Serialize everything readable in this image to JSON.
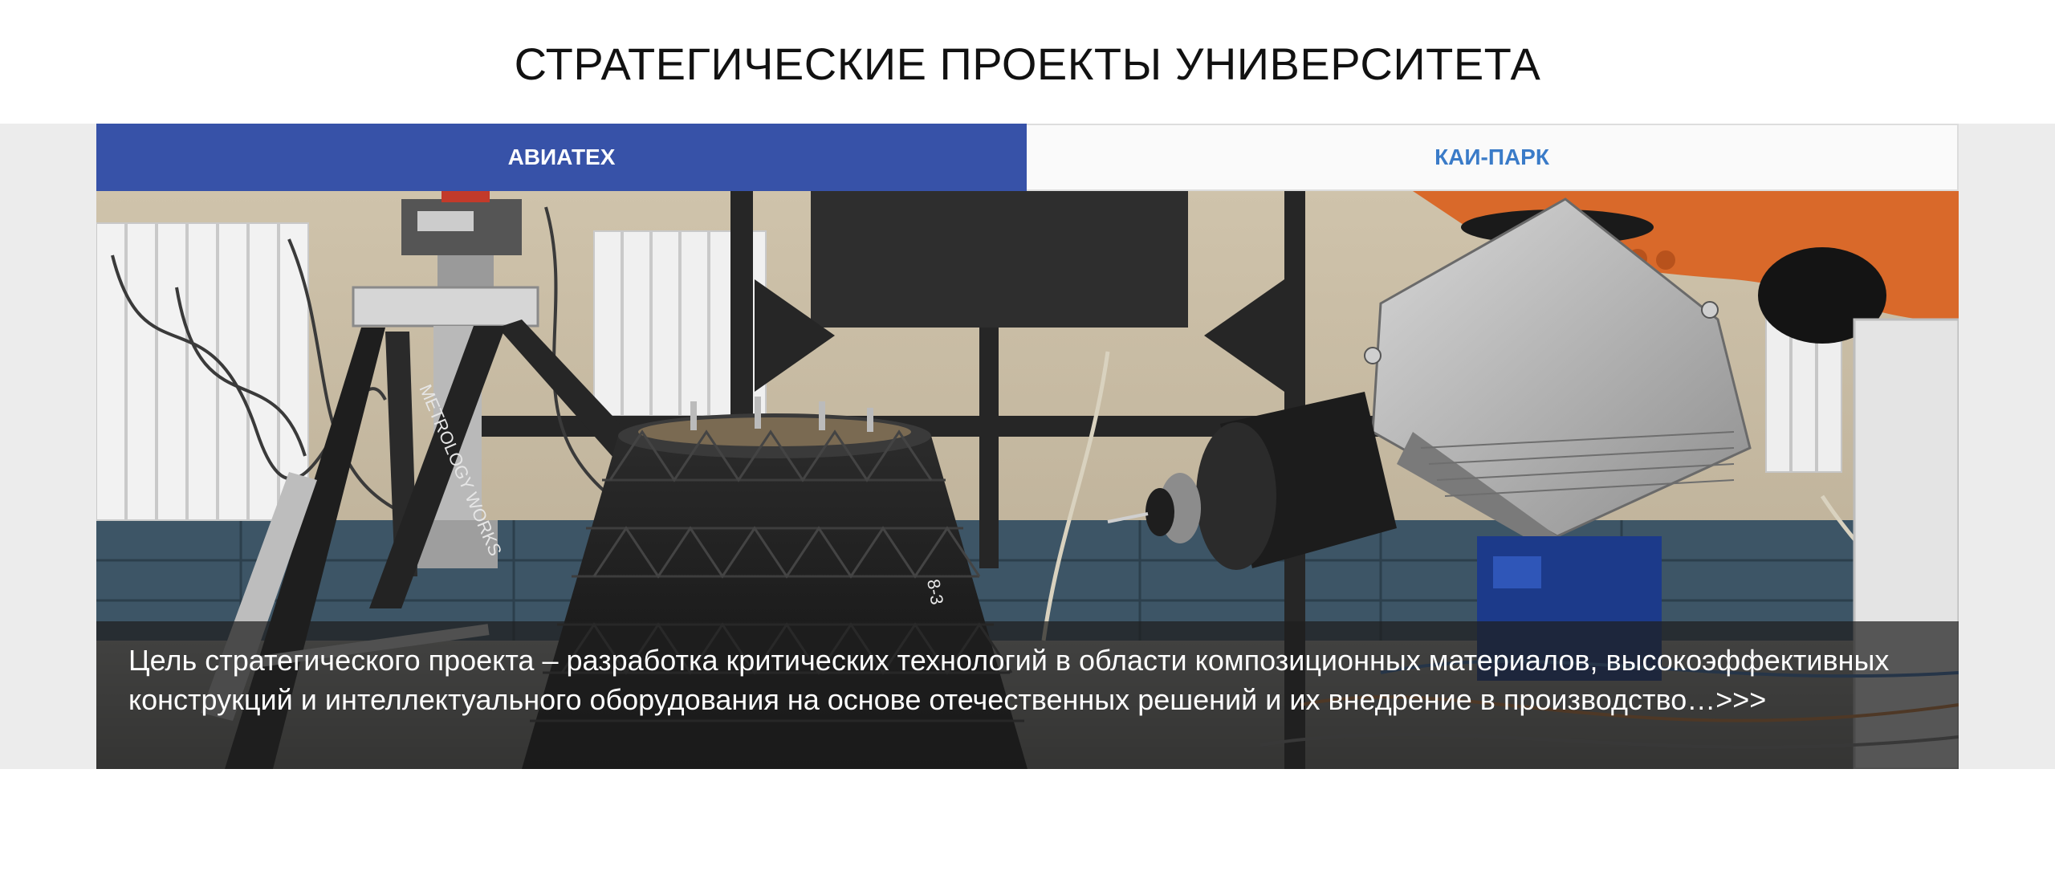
{
  "page": {
    "title": "СТРАТЕГИЧЕСКИЕ ПРОЕКТЫ УНИВЕРСИТЕТА"
  },
  "tabs": [
    {
      "label": "АВИАТЕХ",
      "active": true
    },
    {
      "label": "КАИ-ПАРК",
      "active": false
    }
  ],
  "slide": {
    "caption": "Цель стратегического проекта – разработка критических технологий в области композиционных материалов, высокоэффективных конструкций и интеллектуального оборудования на основе отечественных решений и их внедрение в производство…>>>",
    "image_alt": "photo-industrial-robot-composite-lab",
    "tripod_brand": "METROLOGY WORKS"
  },
  "colors": {
    "accent": "#3752a8",
    "tab_link": "#3a7bc8",
    "band": "#ececec",
    "robot_orange": "#d9692a"
  }
}
